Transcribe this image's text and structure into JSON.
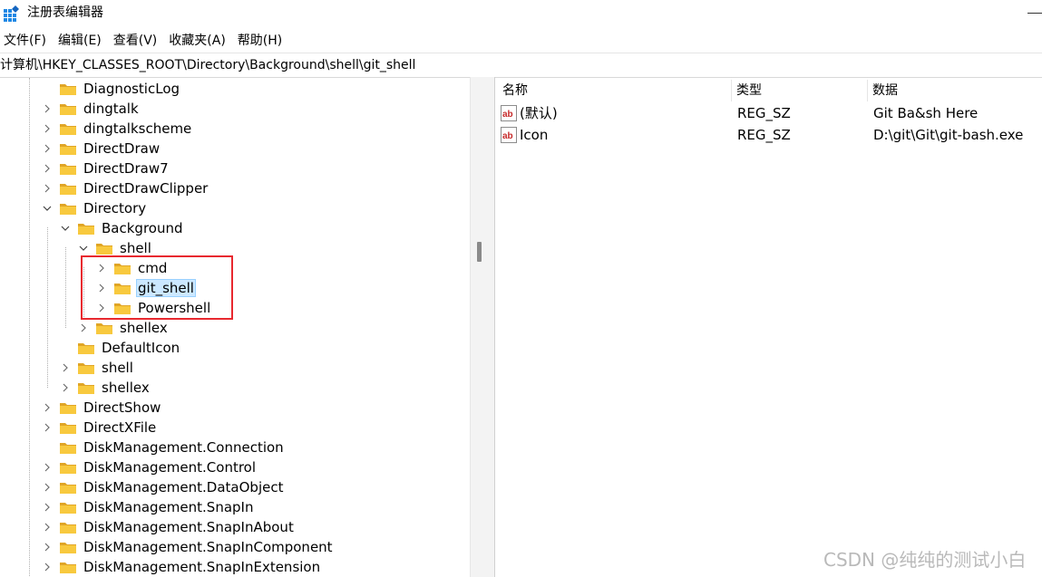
{
  "window": {
    "title": "注册表编辑器"
  },
  "menu": [
    "文件(F)",
    "编辑(E)",
    "查看(V)",
    "收藏夹(A)",
    "帮助(H)"
  ],
  "address": {
    "path": "计算机\\HKEY_CLASSES_ROOT\\Directory\\Background\\shell\\git_shell"
  },
  "tree": {
    "items": [
      {
        "label": "DiagnosticLog",
        "expander": "none"
      },
      {
        "label": "dingtalk",
        "expander": "collapsed"
      },
      {
        "label": "dingtalkscheme",
        "expander": "collapsed"
      },
      {
        "label": "DirectDraw",
        "expander": "collapsed"
      },
      {
        "label": "DirectDraw7",
        "expander": "collapsed"
      },
      {
        "label": "DirectDrawClipper",
        "expander": "collapsed"
      },
      {
        "label": "Directory",
        "expander": "expanded"
      },
      {
        "label": "Background",
        "expander": "expanded"
      },
      {
        "label": "shell",
        "expander": "expanded"
      },
      {
        "label": "cmd",
        "expander": "collapsed"
      },
      {
        "label": "git_shell",
        "expander": "collapsed",
        "selected": true
      },
      {
        "label": "Powershell",
        "expander": "collapsed"
      },
      {
        "label": "shellex",
        "expander": "collapsed"
      },
      {
        "label": "DefaultIcon",
        "expander": "none"
      },
      {
        "label": "shell",
        "expander": "collapsed"
      },
      {
        "label": "shellex",
        "expander": "collapsed"
      },
      {
        "label": "DirectShow",
        "expander": "collapsed"
      },
      {
        "label": "DirectXFile",
        "expander": "collapsed"
      },
      {
        "label": "DiskManagement.Connection",
        "expander": "none"
      },
      {
        "label": "DiskManagement.Control",
        "expander": "collapsed"
      },
      {
        "label": "DiskManagement.DataObject",
        "expander": "collapsed"
      },
      {
        "label": "DiskManagement.SnapIn",
        "expander": "collapsed"
      },
      {
        "label": "DiskManagement.SnapInAbout",
        "expander": "collapsed"
      },
      {
        "label": "DiskManagement.SnapInComponent",
        "expander": "collapsed"
      },
      {
        "label": "DiskManagement.SnapInExtension",
        "expander": "collapsed"
      }
    ]
  },
  "values": {
    "columns": [
      "名称",
      "类型",
      "数据"
    ],
    "rows": [
      {
        "name": "(默认)",
        "type": "REG_SZ",
        "data": "Git Ba&sh Here",
        "icon": "string-value-icon"
      },
      {
        "name": "Icon",
        "type": "REG_SZ",
        "data": "D:\\git\\Git\\git-bash.exe",
        "icon": "string-value-icon"
      }
    ]
  },
  "watermark": "CSDN @纯纯的测试小白",
  "colors": {
    "selection_bg": "#cce8ff",
    "selection_border": "#99d1ff",
    "highlight_box": "#e8292f",
    "folder": "#f8c93e"
  }
}
